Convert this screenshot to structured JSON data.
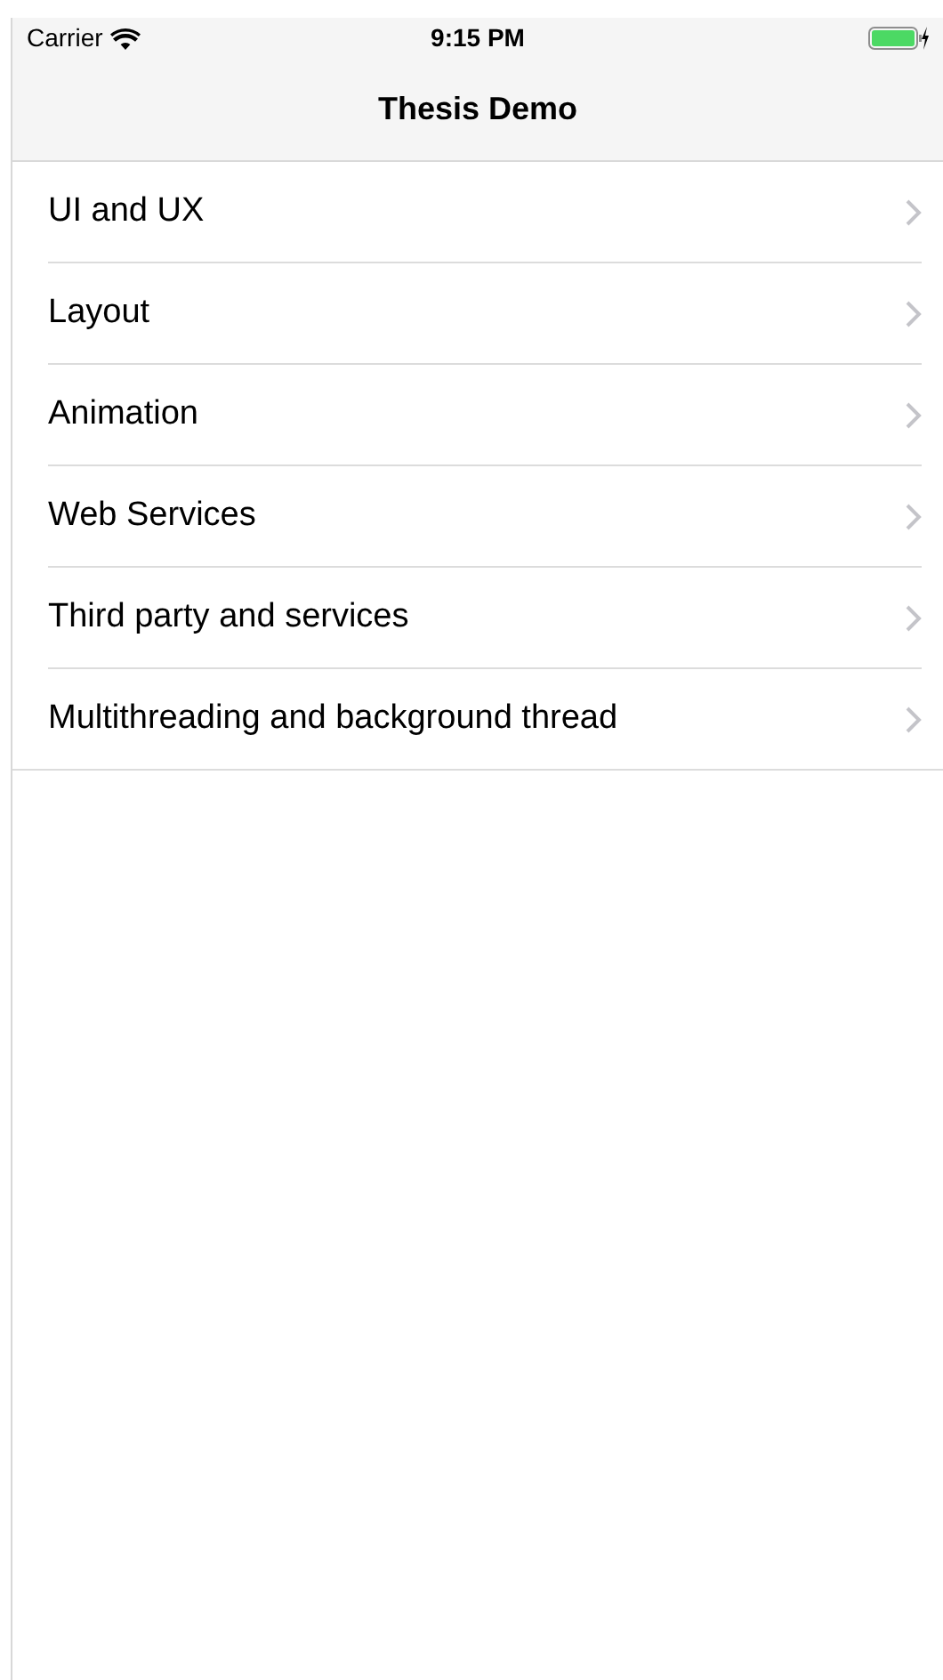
{
  "status_bar": {
    "carrier": "Carrier",
    "time": "9:15 PM"
  },
  "nav_bar": {
    "title": "Thesis Demo"
  },
  "list": {
    "items": [
      {
        "label": "UI and UX"
      },
      {
        "label": "Layout"
      },
      {
        "label": "Animation"
      },
      {
        "label": "Web Services"
      },
      {
        "label": "Third party and services"
      },
      {
        "label": "Multithreading and background thread"
      }
    ]
  }
}
